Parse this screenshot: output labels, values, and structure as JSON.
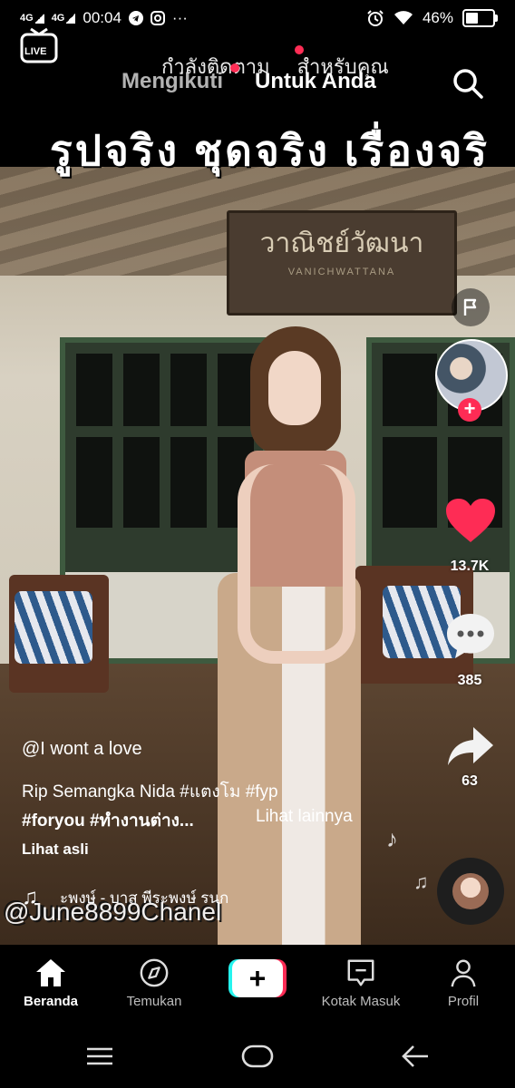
{
  "status_bar": {
    "signal_1": "4G",
    "signal_2": "4G",
    "time": "00:04",
    "more": "···",
    "battery": "46%",
    "battery_level": 0.46
  },
  "video": {
    "overlay_tabs": [
      "กำลังติดตาม",
      "สำหรับคุณ"
    ],
    "title_text": "รูปจริง ชุดจริง เรื่องจริ",
    "sign_text": "วาณิชย์วัฒนา",
    "sign_subtext": "VANICHWATTANA",
    "watermark": "@June8899Chanel"
  },
  "top_nav": {
    "live_label": "LIVE",
    "following_label": "Mengikuti",
    "for_you_label": "Untuk Anda"
  },
  "actions": {
    "likes": "13.7K",
    "comments": "385",
    "shares": "63"
  },
  "caption": {
    "username": "@I wont a love",
    "line1": "Rip Semangka Nida #แตงโม #fyp",
    "line2": "#foryou #ทำงานต่าง...",
    "see_more": "Lihat lainnya",
    "see_original": "Lihat asli",
    "music": "ะพงษ์ - บาส พีระพงษ์    รนก"
  },
  "bottom_nav": {
    "home": "Beranda",
    "discover": "Temukan",
    "create": "+",
    "inbox": "Kotak Masuk",
    "profile": "Profil"
  },
  "colors": {
    "like_red": "#fe2c55",
    "cyan_accent": "#25f4ee",
    "background": "#000000"
  }
}
